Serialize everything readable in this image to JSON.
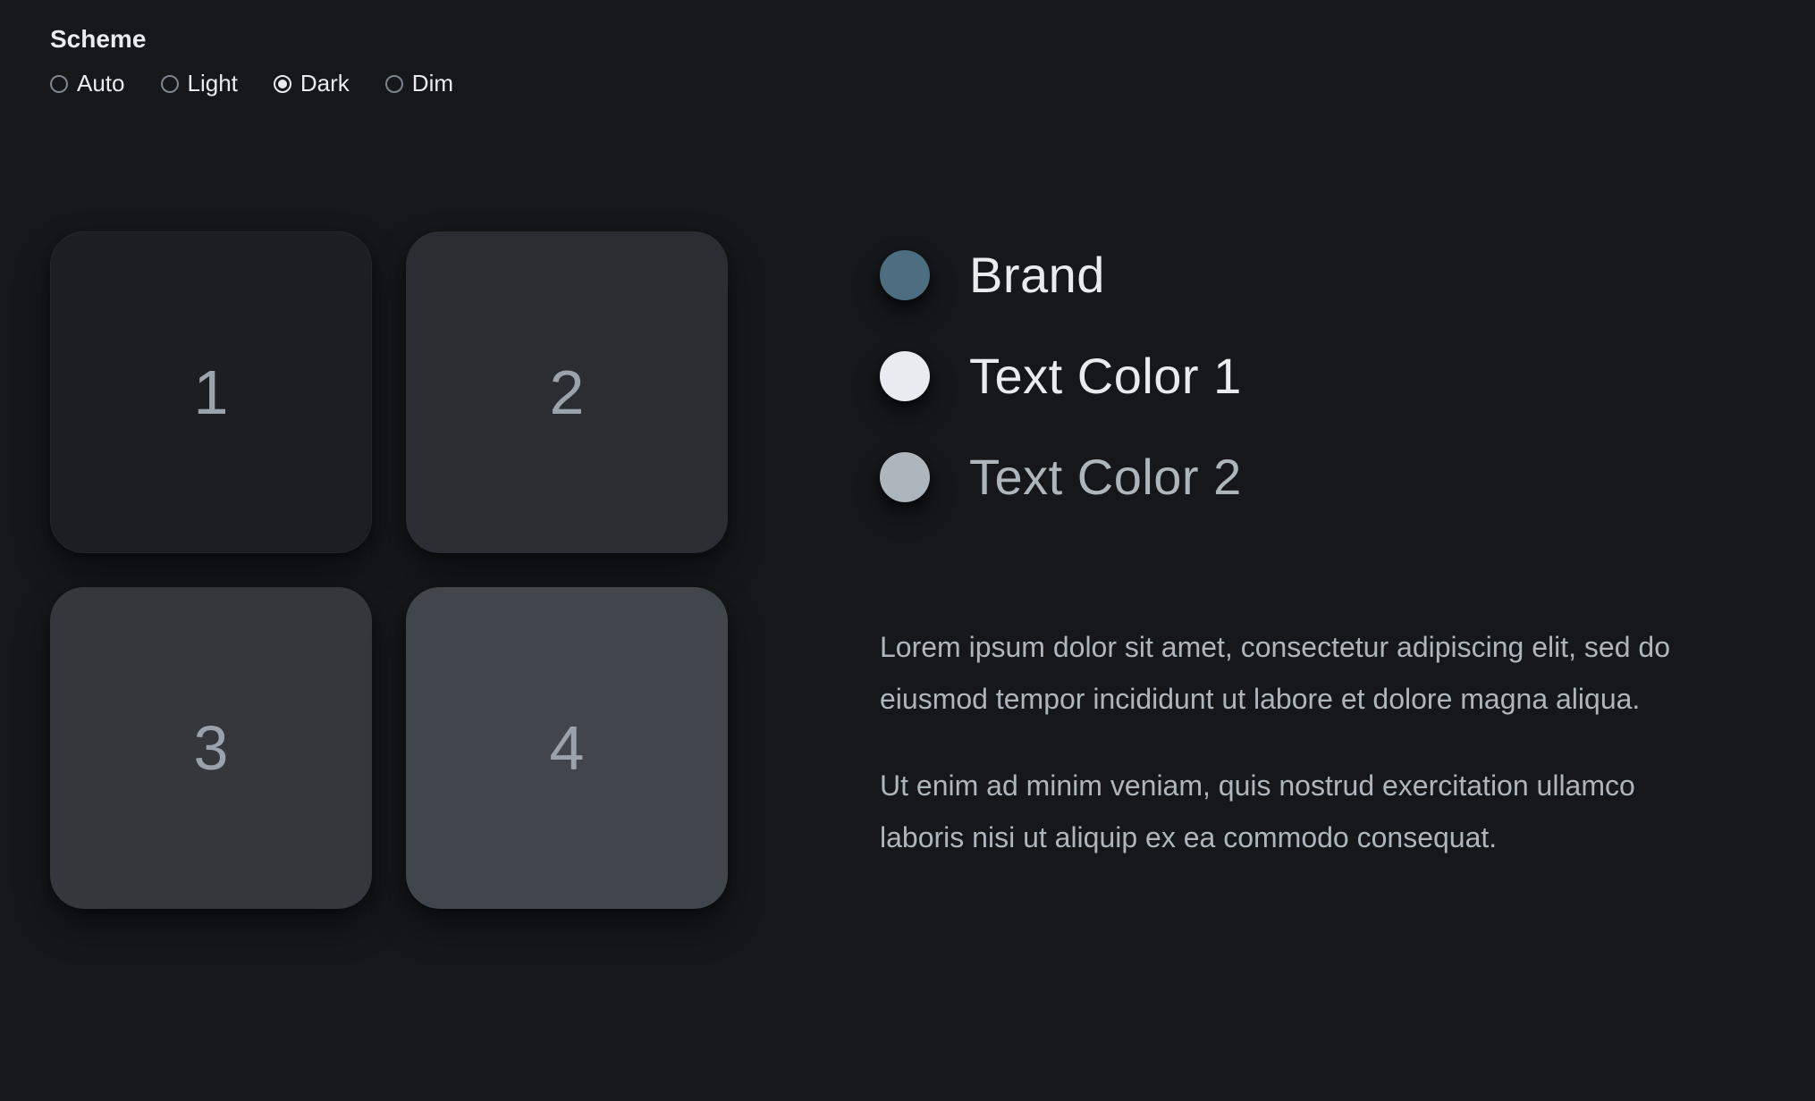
{
  "scheme": {
    "title": "Scheme",
    "options": [
      {
        "label": "Auto",
        "selected": false
      },
      {
        "label": "Light",
        "selected": false
      },
      {
        "label": "Dark",
        "selected": true
      },
      {
        "label": "Dim",
        "selected": false
      }
    ]
  },
  "tiles": [
    {
      "label": "1",
      "bg": "#1c1f22"
    },
    {
      "label": "2",
      "bg": "#2a2d31"
    },
    {
      "label": "3",
      "bg": "#34383d"
    },
    {
      "label": "4",
      "bg": "#41464c"
    }
  ],
  "swatches": [
    {
      "label": "Brand",
      "color": "#4d6d80",
      "text_color": "#e8ecf0"
    },
    {
      "label": "Text Color 1",
      "color": "#e8ecf0",
      "text_color": "#e8ecf0"
    },
    {
      "label": "Text Color 2",
      "color": "#aeb6bd",
      "text_color": "#aeb6bd"
    }
  ],
  "paragraphs": {
    "p1": "Lorem ipsum dolor sit amet, consectetur adipiscing elit, sed do eiusmod tempor incididunt ut labore et dolore magna aliqua.",
    "p2": "Ut enim ad minim veniam, quis nostrud exercitation ullamco laboris nisi ut aliquip ex ea commodo consequat."
  }
}
